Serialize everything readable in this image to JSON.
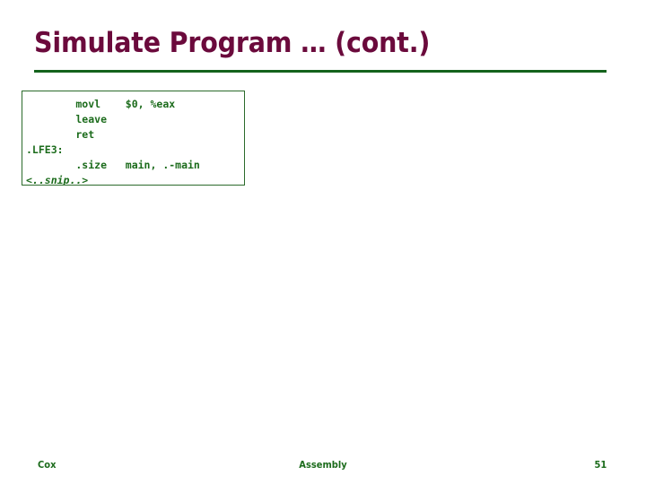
{
  "slide": {
    "title": "Simulate Program … (cont.)",
    "accent_color": "#6B0A3C",
    "rule_color": "#14631C",
    "background_color": "#FFFFFF"
  },
  "code_block": {
    "text_color": "#1B6B1B",
    "border_color": "#2B6B2B",
    "lines": [
      {
        "text": "        movl    $0, %eax",
        "style": "normal"
      },
      {
        "text": "        leave",
        "style": "normal"
      },
      {
        "text": "        ret",
        "style": "normal"
      },
      {
        "text": ".LFE3:",
        "style": "normal"
      },
      {
        "text": "        .size   main, .-main",
        "style": "normal"
      },
      {
        "text": "<..snip..>",
        "style": "italic"
      }
    ]
  },
  "footer": {
    "author": "Cox",
    "topic": "Assembly",
    "page_number": "51",
    "text_color": "#1B6B1B"
  }
}
